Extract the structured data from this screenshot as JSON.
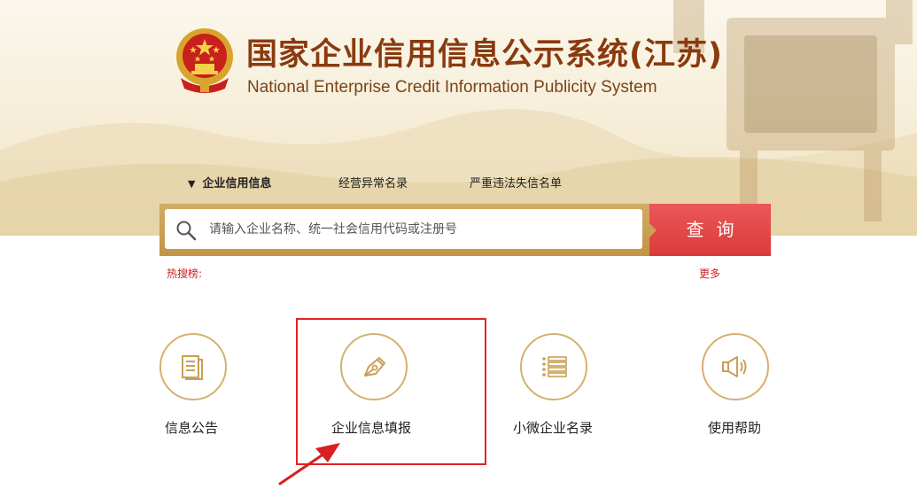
{
  "header": {
    "title_cn": "国家企业信用信息公示系统(江苏)",
    "title_en": "National Enterprise Credit Information Publicity System",
    "emblem_icon": "national-emblem-icon"
  },
  "tabs": [
    {
      "label": "企业信用信息",
      "active": true
    },
    {
      "label": "经营异常名录",
      "active": false
    },
    {
      "label": "严重违法失信名单",
      "active": false
    }
  ],
  "search": {
    "placeholder": "请输入企业名称、统一社会信用代码或注册号",
    "button_label": "查询",
    "hot_label": "热搜榜:",
    "more_label": "更多"
  },
  "features": [
    {
      "label": "信息公告",
      "icon": "document-icon"
    },
    {
      "label": "企业信息填报",
      "icon": "pen-icon",
      "highlighted": true
    },
    {
      "label": "小微企业名录",
      "icon": "list-icon"
    },
    {
      "label": "使用帮助",
      "icon": "megaphone-icon"
    }
  ],
  "colors": {
    "brand_gold": "#c29445",
    "accent_red": "#e04848",
    "title_brown": "#8a3a0f"
  }
}
